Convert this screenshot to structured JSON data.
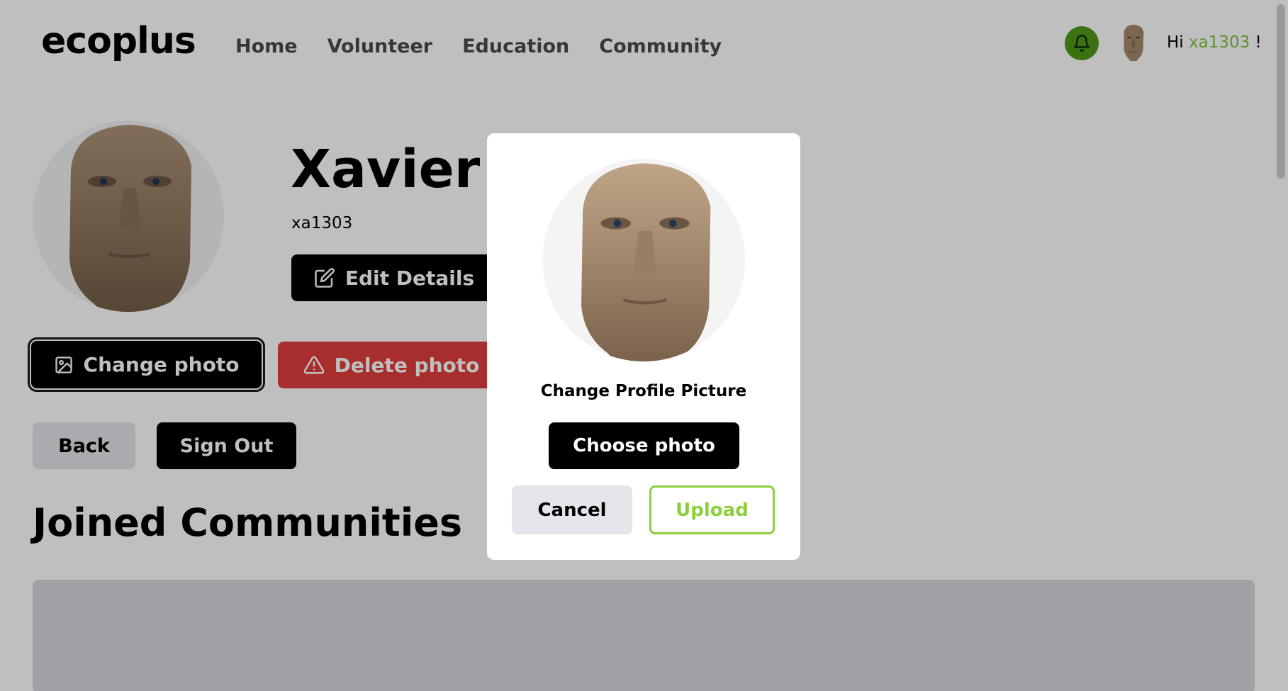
{
  "header": {
    "logo": "ecoplus",
    "nav": [
      "Home",
      "Volunteer",
      "Education",
      "Community"
    ],
    "greeting_prefix": "Hi ",
    "username": "xa1303",
    "greeting_suffix": " !"
  },
  "profile": {
    "full_name": "Xavier A",
    "username": "xa1303",
    "edit_label": "Edit Details",
    "change_photo_label": "Change photo",
    "delete_photo_label": "Delete photo",
    "back_label": "Back",
    "signout_label": "Sign Out"
  },
  "communities": {
    "title": "Joined Communities"
  },
  "modal": {
    "title": "Change Profile Picture",
    "choose_label": "Choose photo",
    "cancel_label": "Cancel",
    "upload_label": "Upload"
  },
  "colors": {
    "accent_green": "#7cc242",
    "bell_green": "#4f9a1a",
    "danger_red": "#e03e3e"
  },
  "icons": {
    "bell": "bell-icon",
    "edit": "edit-icon",
    "image": "image-icon",
    "warning": "warning-icon"
  }
}
